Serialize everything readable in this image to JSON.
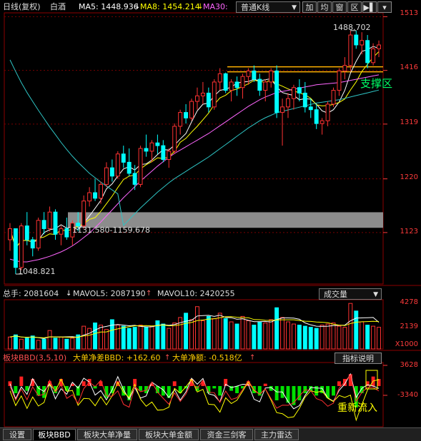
{
  "header": {
    "title": "日线(复权)",
    "stock": "白酒",
    "ma5_label": "MA5: 1448.936",
    "ma8_label": "MA8: 1454.214",
    "ma30_label": "MA30:",
    "kline_type": "普通K线",
    "buttons": [
      "加",
      "均",
      "窗",
      "区"
    ],
    "colors": {
      "ma5": "#ffffff",
      "ma8": "#ffff00",
      "ma30": "#ff66ff",
      "up": "#ff3232",
      "down": "#00ffff"
    }
  },
  "price_axis": {
    "ticks": [
      "1513",
      "1416",
      "1319",
      "1220",
      "1123"
    ]
  },
  "annotations": {
    "high": "1488.702",
    "low": "1048.821",
    "band_label": "1131.580-1159.678",
    "support_label": "支撑区",
    "inflow_label": "重新流入"
  },
  "volume_panel": {
    "total_label": "总手: 2081604",
    "mavol5_label": "MAVOL5: 2087190",
    "mavol10_label": "MAVOL10: 2420255",
    "selector": "成交量",
    "ticks": [
      "4278",
      "2139",
      "X1000"
    ]
  },
  "bbd_panel": {
    "title": "板块BBD(3,5,10)",
    "net_label": "大单净差BBD: +162.60",
    "amount_label": "大单净额: -0.518亿",
    "help_button": "指标说明",
    "ticks": [
      "3628",
      "-3340"
    ]
  },
  "tabs": [
    "设置",
    "板块BBD",
    "板块大单净量",
    "板块大单金额",
    "资金三剑客",
    "主力雷达"
  ],
  "chart_data": {
    "type": "candlestick",
    "ylim": [
      1030,
      1520
    ],
    "candles": [
      [
        1110,
        1140,
        1090,
        1130
      ],
      [
        1130,
        1130,
        1048,
        1060
      ],
      [
        1060,
        1140,
        1055,
        1135
      ],
      [
        1135,
        1160,
        1100,
        1110
      ],
      [
        1110,
        1115,
        1080,
        1095
      ],
      [
        1095,
        1150,
        1090,
        1145
      ],
      [
        1145,
        1160,
        1120,
        1130
      ],
      [
        1130,
        1170,
        1125,
        1160
      ],
      [
        1160,
        1165,
        1110,
        1120
      ],
      [
        1120,
        1135,
        1100,
        1130
      ],
      [
        1130,
        1150,
        1110,
        1115
      ],
      [
        1115,
        1145,
        1100,
        1140
      ],
      [
        1140,
        1160,
        1125,
        1135
      ],
      [
        1135,
        1190,
        1130,
        1180
      ],
      [
        1180,
        1205,
        1170,
        1195
      ],
      [
        1195,
        1220,
        1180,
        1185
      ],
      [
        1185,
        1215,
        1175,
        1210
      ],
      [
        1210,
        1250,
        1205,
        1240
      ],
      [
        1240,
        1255,
        1215,
        1225
      ],
      [
        1225,
        1270,
        1220,
        1265
      ],
      [
        1265,
        1280,
        1240,
        1250
      ],
      [
        1250,
        1275,
        1225,
        1230
      ],
      [
        1230,
        1245,
        1200,
        1210
      ],
      [
        1210,
        1280,
        1205,
        1275
      ],
      [
        1275,
        1300,
        1260,
        1270
      ],
      [
        1270,
        1290,
        1250,
        1285
      ],
      [
        1285,
        1300,
        1265,
        1280
      ],
      [
        1280,
        1290,
        1250,
        1255
      ],
      [
        1255,
        1275,
        1240,
        1270
      ],
      [
        1270,
        1320,
        1265,
        1315
      ],
      [
        1315,
        1345,
        1300,
        1340
      ],
      [
        1340,
        1355,
        1320,
        1330
      ],
      [
        1330,
        1365,
        1325,
        1360
      ],
      [
        1360,
        1385,
        1345,
        1370
      ],
      [
        1370,
        1395,
        1355,
        1375
      ],
      [
        1375,
        1385,
        1340,
        1350
      ],
      [
        1350,
        1400,
        1345,
        1395
      ],
      [
        1395,
        1420,
        1380,
        1410
      ],
      [
        1410,
        1412,
        1375,
        1380
      ],
      [
        1380,
        1400,
        1360,
        1395
      ],
      [
        1395,
        1405,
        1370,
        1385
      ],
      [
        1385,
        1410,
        1365,
        1405
      ],
      [
        1405,
        1420,
        1390,
        1415
      ],
      [
        1415,
        1425,
        1395,
        1400
      ],
      [
        1400,
        1410,
        1370,
        1380
      ],
      [
        1380,
        1400,
        1360,
        1395
      ],
      [
        1395,
        1420,
        1385,
        1415
      ],
      [
        1415,
        1425,
        1330,
        1340
      ],
      [
        1340,
        1365,
        1280,
        1350
      ],
      [
        1350,
        1375,
        1330,
        1365
      ],
      [
        1365,
        1390,
        1345,
        1385
      ],
      [
        1385,
        1400,
        1360,
        1375
      ],
      [
        1375,
        1395,
        1340,
        1350
      ],
      [
        1350,
        1365,
        1330,
        1345
      ],
      [
        1345,
        1355,
        1310,
        1320
      ],
      [
        1320,
        1330,
        1300,
        1325
      ],
      [
        1325,
        1360,
        1315,
        1355
      ],
      [
        1355,
        1385,
        1350,
        1380
      ],
      [
        1380,
        1420,
        1370,
        1415
      ],
      [
        1415,
        1440,
        1400,
        1425
      ],
      [
        1425,
        1488,
        1415,
        1480
      ],
      [
        1480,
        1488,
        1455,
        1462
      ],
      [
        1462,
        1485,
        1445,
        1470
      ],
      [
        1470,
        1480,
        1420,
        1430
      ],
      [
        1430,
        1465,
        1425,
        1455
      ],
      [
        1455,
        1470,
        1440,
        1462
      ]
    ],
    "ma30": [
      1075,
      1072,
      1070,
      1070,
      1072,
      1074,
      1077,
      1080,
      1084,
      1088,
      1093,
      1099,
      1106,
      1114,
      1122,
      1132,
      1142,
      1153,
      1164,
      1175,
      1186,
      1196,
      1206,
      1216,
      1225,
      1234,
      1243,
      1251,
      1259,
      1266,
      1272,
      1278,
      1284,
      1290,
      1296,
      1302,
      1309,
      1316,
      1323,
      1330,
      1337,
      1344,
      1351,
      1357,
      1363,
      1368,
      1372,
      1376,
      1378,
      1380,
      1382,
      1384,
      1386,
      1388,
      1390,
      1391,
      1392,
      1393,
      1394,
      1396,
      1398,
      1400,
      1402,
      1404,
      1406,
      1408
    ],
    "volume": [
      1100,
      1300,
      900,
      1000,
      1200,
      800,
      900,
      1700,
      1000,
      1100,
      900,
      1000,
      1300,
      2100,
      1900,
      2400,
      2200,
      1800,
      2700,
      2200,
      2100,
      1900,
      2000,
      2200,
      2000,
      2100,
      2600,
      2300,
      1900,
      2400,
      2900,
      3300,
      2700,
      3900,
      2600,
      3000,
      2800,
      3300,
      2800,
      2500,
      2300,
      3000,
      2600,
      2200,
      2500,
      2400,
      2700,
      3800,
      2900,
      2500,
      2300,
      2200,
      2100,
      2000,
      1900,
      2200,
      2300,
      2400,
      2100,
      2000,
      4200,
      3500,
      2500,
      2200,
      2100,
      2000
    ],
    "bbd": [
      200,
      -300,
      400,
      -200,
      300,
      -400,
      -500,
      200,
      -300,
      300,
      -200,
      100,
      -400,
      200,
      300,
      -100,
      200,
      -500,
      -300,
      200,
      -400,
      -600,
      300,
      -200,
      -300,
      100,
      -300,
      -400,
      -500,
      200,
      -300,
      -100,
      300,
      -200,
      200,
      -300,
      -100,
      -400,
      300,
      -200,
      -300,
      -100,
      200,
      -300,
      -400,
      100,
      -200,
      -600,
      -500,
      -700,
      -800,
      -600,
      -300,
      -200,
      -400,
      -300,
      -500,
      -400,
      200,
      300,
      500,
      -900,
      -300,
      200,
      400,
      300
    ]
  }
}
